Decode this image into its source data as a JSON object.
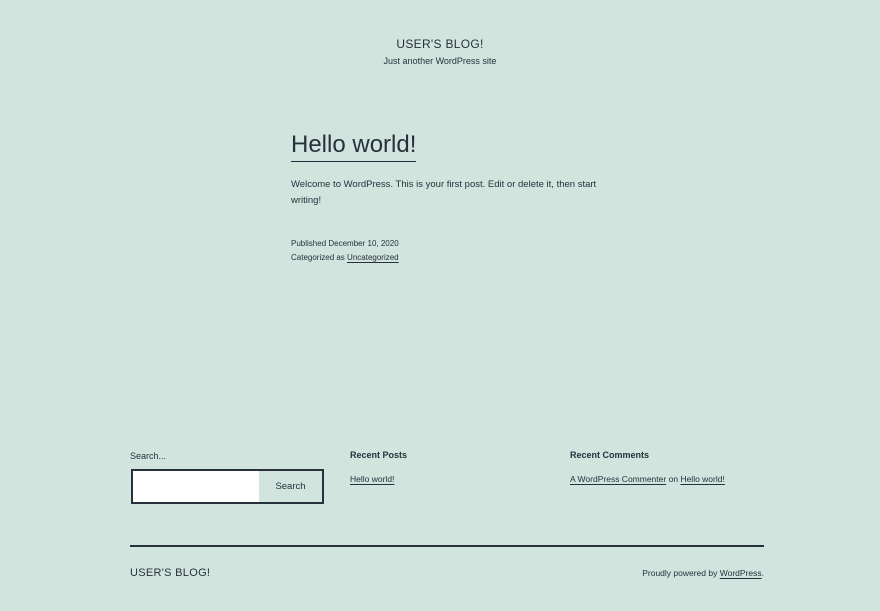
{
  "header": {
    "site_title": "USER'S BLOG!",
    "site_description": "Just another WordPress site"
  },
  "post": {
    "title": "Hello world!",
    "body": "Welcome to WordPress. This is your first post. Edit or delete it, then start writing!",
    "published_prefix": "Published",
    "published_date": "December 10, 2020",
    "categorized_prefix": "Categorized as",
    "category": "Uncategorized"
  },
  "widgets": {
    "search": {
      "label": "Search...",
      "value": "",
      "button_label": "Search"
    },
    "recent_posts": {
      "title": "Recent Posts",
      "items": [
        "Hello world!"
      ]
    },
    "recent_comments": {
      "title": "Recent Comments",
      "author": "A WordPress Commenter",
      "connector": "on",
      "post": "Hello world!"
    }
  },
  "footer": {
    "site_title": "USER'S BLOG!",
    "powered_prefix": "Proudly powered by",
    "powered_link": "WordPress",
    "powered_suffix": "."
  },
  "colors": {
    "background": "#d1e4dd",
    "text": "#28303d",
    "input_background": "#ffffff"
  }
}
